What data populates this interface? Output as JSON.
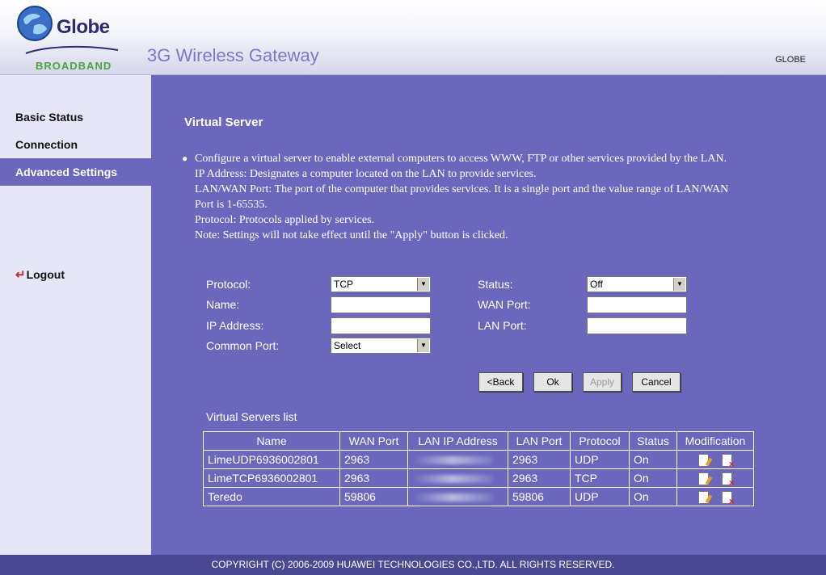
{
  "header": {
    "logo_word": "Globe",
    "logo_sub": "BROADBAND",
    "app_title": "3G Wireless Gateway",
    "brand": "GLOBE"
  },
  "sidebar": {
    "items": [
      {
        "label": "Basic Status"
      },
      {
        "label": "Connection"
      },
      {
        "label": "Advanced Settings"
      }
    ],
    "active_index": 2,
    "logout_label": "Logout"
  },
  "main": {
    "title": "Virtual Server",
    "description": [
      "Configure a virtual server to enable external computers to access WWW, FTP or other services provided by the LAN.",
      "IP Address: Designates a computer located on the LAN to provide services.",
      "LAN/WAN Port: The port of the computer that provides services. It is a single port and the value range of LAN/WAN Port is 1-65535.",
      "Protocol: Protocols applied by services.",
      "Note: Settings will not take effect until the \"Apply\" button is clicked."
    ]
  },
  "form": {
    "protocol_label": "Protocol:",
    "protocol_value": "TCP",
    "name_label": "Name:",
    "name_value": "",
    "ip_label": "IP Address:",
    "ip_value": "",
    "common_port_label": "Common Port:",
    "common_port_value": "Select",
    "status_label": "Status:",
    "status_value": "Off",
    "wan_port_label": "WAN Port:",
    "wan_port_value": "",
    "lan_port_label": "LAN Port:",
    "lan_port_value": ""
  },
  "buttons": {
    "back": "<Back",
    "ok": "Ok",
    "apply": "Apply",
    "cancel": "Cancel"
  },
  "list": {
    "title": "Virtual Servers list",
    "columns": [
      "Name",
      "WAN Port",
      "LAN IP Address",
      "LAN Port",
      "Protocol",
      "Status",
      "Modification"
    ],
    "rows": [
      {
        "name": "LimeUDP6936002801",
        "wan_port": "2963",
        "lan_ip": "",
        "lan_port": "2963",
        "protocol": "UDP",
        "status": "On"
      },
      {
        "name": "LimeTCP6936002801",
        "wan_port": "2963",
        "lan_ip": "",
        "lan_port": "2963",
        "protocol": "TCP",
        "status": "On"
      },
      {
        "name": "Teredo",
        "wan_port": "59806",
        "lan_ip": "",
        "lan_port": "59806",
        "protocol": "UDP",
        "status": "On"
      }
    ]
  },
  "footer": {
    "copyright": "COPYRIGHT (C) 2006-2009 HUAWEI TECHNOLOGIES CO.,LTD. ALL RIGHTS RESERVED."
  },
  "colors": {
    "main_bg": "#6a67bd",
    "sidebar_bg": "#e6e6f7",
    "footer_bg": "#4a4890",
    "title_color": "#7a78c8"
  },
  "icons": {
    "logo": "globe-logo-icon",
    "logout": "logout-arrow-icon",
    "edit": "edit-document-icon",
    "delete": "delete-document-icon",
    "dropdown": "chevron-down-icon"
  }
}
